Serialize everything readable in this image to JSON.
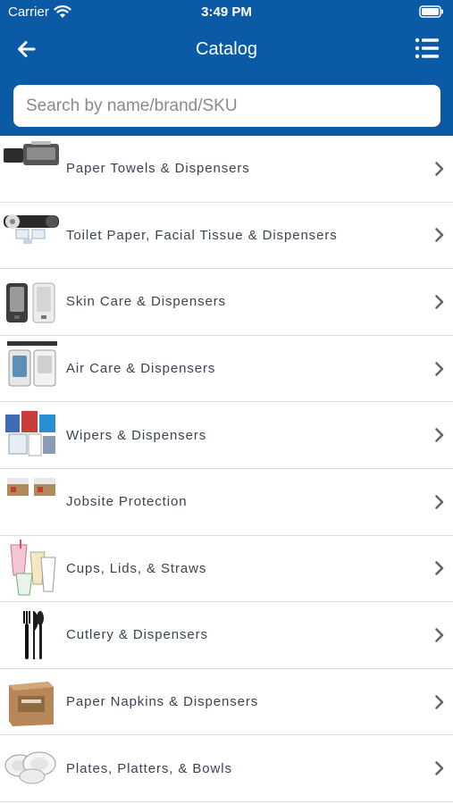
{
  "status_bar": {
    "carrier": "Carrier",
    "time": "3:49 PM"
  },
  "nav": {
    "title": "Catalog",
    "back_icon": "arrow-left-icon",
    "menu_icon": "list-menu-icon"
  },
  "search": {
    "placeholder": "Search by name/brand/SKU",
    "value": ""
  },
  "catalog": {
    "items": [
      {
        "label": "Paper Towels & Dispensers",
        "thumb": "paper-towel-dispenser"
      },
      {
        "label": "Toilet Paper, Facial Tissue & Dispensers",
        "thumb": "toilet-paper-dispenser"
      },
      {
        "label": "Skin Care & Dispensers",
        "thumb": "soap-dispenser"
      },
      {
        "label": "Air Care & Dispensers",
        "thumb": "air-freshener-dispenser"
      },
      {
        "label": "Wipers & Dispensers",
        "thumb": "wipers"
      },
      {
        "label": "Jobsite Protection",
        "thumb": "jobsite-boxes"
      },
      {
        "label": "Cups, Lids, & Straws",
        "thumb": "cups"
      },
      {
        "label": "Cutlery & Dispensers",
        "thumb": "cutlery"
      },
      {
        "label": "Paper Napkins & Dispensers",
        "thumb": "napkins"
      },
      {
        "label": "Plates, Platters, & Bowls",
        "thumb": "plates"
      }
    ]
  },
  "colors": {
    "header_bg": "#0b5aa6",
    "divider": "#dcdcdc",
    "label_text": "#3a4452",
    "chevron": "#666666"
  }
}
